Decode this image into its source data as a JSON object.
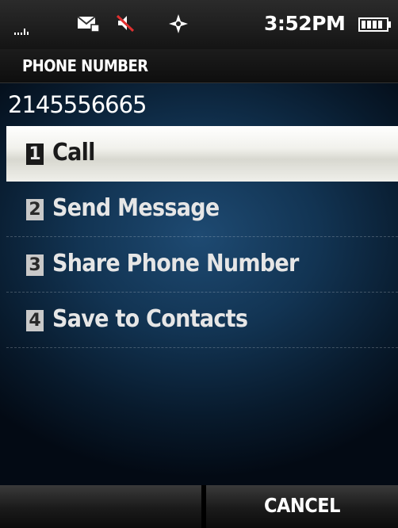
{
  "status_bar": {
    "time": "3:52PM",
    "icons": [
      "signal-icon",
      "message-icon",
      "mute-icon",
      "gps-icon",
      "battery-icon"
    ]
  },
  "header": {
    "title": "PHONE NUMBER"
  },
  "phone_number": "2145556665",
  "menu": {
    "selected_index": 0,
    "items": [
      {
        "number": "1",
        "label": "Call"
      },
      {
        "number": "2",
        "label": "Send Message"
      },
      {
        "number": "3",
        "label": "Share Phone Number"
      },
      {
        "number": "4",
        "label": "Save to Contacts"
      }
    ]
  },
  "softkeys": {
    "left_label": "",
    "right_label": "CANCEL"
  },
  "colors": {
    "selection": "#f1f1ec",
    "background_center": "#1e4a72",
    "background_edge": "#030a14"
  }
}
